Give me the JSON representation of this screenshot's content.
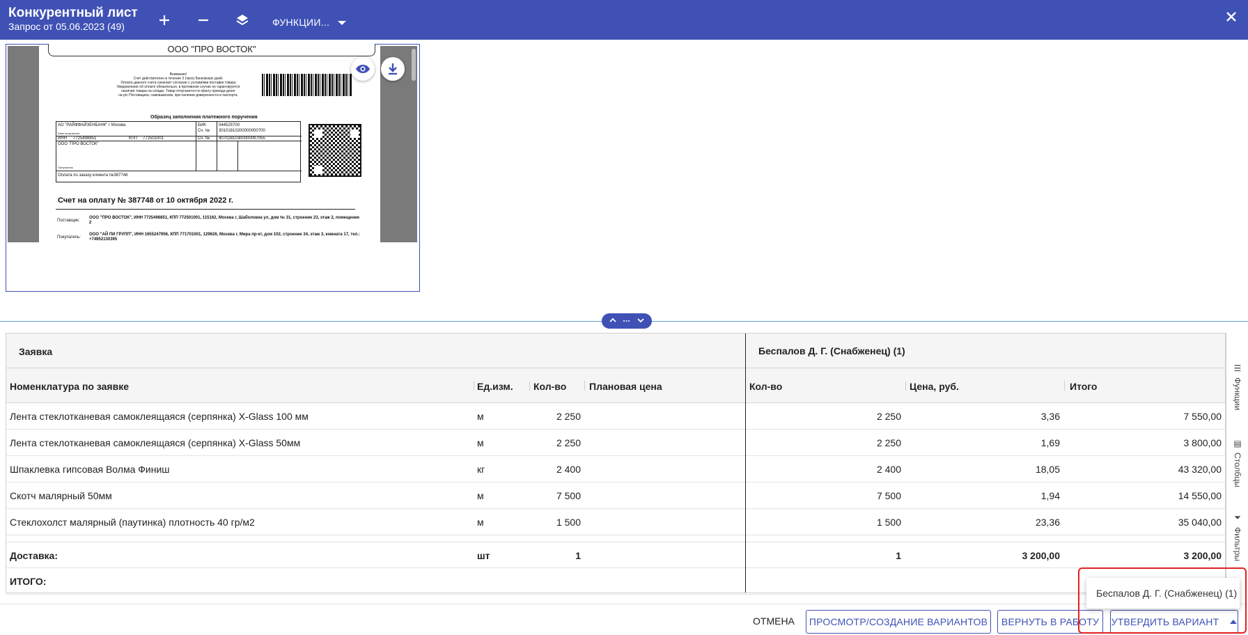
{
  "header": {
    "title": "Конкурентный лист",
    "subtitle": "Запрос от 05.06.2023 (49)",
    "functions_label": "ФУНКЦИИ..."
  },
  "preview": {
    "company_tab": "ООО \"ПРО ВОСТОК\"",
    "scan": {
      "notice_lines": [
        "Внимание!",
        "Счет действителен в течение 3 (трех) банковских дней.",
        "Оплата данного счета означает согласие с условиями поставки товара",
        "Уведомление об оплате обязательно, в противном случае не гарантируется",
        "наличие товара на складе. Товар отпускается по факту прихода денег",
        "на р/с Поставщика, самовывозом, при наличии доверенности и паспорта."
      ],
      "form_heading": "Образец заполнения платежного поручения",
      "bank_name": "АО \"РАЙФФАЙЗЕНБАНК\" г Москва",
      "bank_label": "Банк получателя",
      "bik_label": "БИК",
      "bik_value": "044525700",
      "corr_label": "Сч. №",
      "corr_value": "30101810200000000700",
      "inn_label": "ИНН",
      "inn_value": "7725498851",
      "kpp_label": "КПП",
      "kpp_value": "772501001",
      "account_label": "Сч. №",
      "account_value": "40702810300000097055",
      "recipient": "ООО \"ПРО ВОСТОК\"",
      "recipient_label": "Получатель",
      "purpose": "Оплата по заказу клиента №387748",
      "invoice_title": "Счет на оплату № 387748 от 10 октября 2022 г.",
      "supplier_label": "Поставщик:",
      "supplier_text": "ООО \"ПРО ВОСТОК\", ИНН 7725498851, КПП 772501001, 115162, Москва г, Шаболовка ул, дом № 31, строение 23, этаж 2, помещение 2",
      "buyer_label": "Покупатель:",
      "buyer_text": "ООО \"АЙ ПИ ГРУПП\", ИНН 1655247956, КПП 771701001, 129626, Москва г, Мира пр-кт, дом 102, строение 34, этаж 3, комната 17, тел.: +74952130395"
    }
  },
  "grid": {
    "group_request": "Заявка",
    "group_supplier": "Беспалов Д. Г. (Снабженец) (1)",
    "columns": {
      "nomenclature": "Номенклатура по заявке",
      "unit": "Ед.изм.",
      "qty": "Кол-во",
      "planned_price": "Плановая цена",
      "s_qty": "Кол-во",
      "s_price": "Цена, руб.",
      "s_total": "Итого"
    },
    "rows": [
      {
        "name": "Лента стеклотканевая самоклеящаяся (серпянка) X-Glass 100 мм",
        "unit": "м",
        "qty": "2 250",
        "planned": "",
        "s_qty": "2 250",
        "s_price": "3,36",
        "s_total": "7 550,00"
      },
      {
        "name": "Лента стеклотканевая самоклеящаяся (серпянка) X-Glass 50мм",
        "unit": "м",
        "qty": "2 250",
        "planned": "",
        "s_qty": "2 250",
        "s_price": "1,69",
        "s_total": "3 800,00"
      },
      {
        "name": "Шпаклевка гипсовая Волма Финиш",
        "unit": "кг",
        "qty": "2 400",
        "planned": "",
        "s_qty": "2 400",
        "s_price": "18,05",
        "s_total": "43 320,00"
      },
      {
        "name": "Скотч малярный 50мм",
        "unit": "м",
        "qty": "7 500",
        "planned": "",
        "s_qty": "7 500",
        "s_price": "1,94",
        "s_total": "14 550,00"
      },
      {
        "name": "Стеклохолст малярный (паутинка) плотность 40 гр/м2",
        "unit": "м",
        "qty": "1 500",
        "planned": "",
        "s_qty": "1 500",
        "s_price": "23,36",
        "s_total": "35 040,00"
      }
    ],
    "delivery": {
      "name": "Доставка:",
      "unit": "шт",
      "qty": "1",
      "s_qty": "1",
      "s_price": "3 200,00",
      "s_total": "3 200,00"
    },
    "total_label": "ИТОГО:"
  },
  "side_panel": {
    "functions": "Функции",
    "columns": "Столбцы",
    "filters": "Фильтры"
  },
  "footer": {
    "cancel": "ОТМЕНА",
    "variants": "ПРОСМОТР/СОЗДАНИЕ ВАРИАНТОВ",
    "return": "ВЕРНУТЬ В РАБОТУ",
    "approve": "УТВЕРДИТЬ ВАРИАНТ"
  },
  "popup": {
    "option": "Беспалов Д. Г. (Снабженец) (1)"
  },
  "colors": {
    "primary": "#3f51b5",
    "highlight": "#e02020"
  }
}
